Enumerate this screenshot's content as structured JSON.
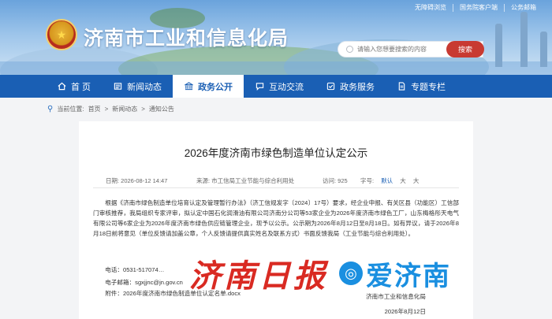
{
  "header": {
    "site_title": "济南市工业和信息化局",
    "top_links": [
      "无障碍浏览",
      "国务院客户端",
      "公务邮箱"
    ],
    "search_placeholder": "请输入您想要搜索的内容",
    "search_button": "搜索"
  },
  "nav": {
    "items": [
      {
        "label": "首 页",
        "icon": "home-icon"
      },
      {
        "label": "新闻动态",
        "icon": "newspaper-icon"
      },
      {
        "label": "政务公开",
        "icon": "government-icon"
      },
      {
        "label": "互动交流",
        "icon": "chat-icon"
      },
      {
        "label": "政务服务",
        "icon": "service-icon"
      },
      {
        "label": "专题专栏",
        "icon": "document-icon"
      }
    ],
    "active_index": 2
  },
  "breadcrumb": {
    "prefix": "当前位置:",
    "items": [
      "首页",
      "新闻动态",
      "通知公告"
    ],
    "separator": ">"
  },
  "article": {
    "title": "2026年度济南市绿色制造单位认定公示",
    "date": "日期: 2026-08-12 14:47",
    "source": "来源: 市工信局工业节能与综合利用处",
    "views": "访问: 925",
    "font_size_label": "字号:",
    "font_sizes": [
      "默认",
      "大",
      "大"
    ],
    "body": "根据《济南市绿色制造单位培育认定及管理暂行办法》（济工信规发字〔2024〕17号）要求，经企业申报、有关区县（功能区）工信部门审核推荐，我局组织专家评审，拟认定中国石化润滑油有限公司济南分公司等53家企业为2026年度济南市绿色工厂，山东梅格彤天电气有限公司等6家企业为2026年度济南市绿色供应链管理企业，现予以公示。公示期为2026年8月12日至8月18日。如有异议，请于2026年8月18日前将意见（单位反馈请加盖公章，个人反馈请提供真实姓名及联系方式）书面反馈我局（工业节能与综合利用处）。",
    "phone": "电话：0531-517074…",
    "email": "电子邮箱：sgxjjnc@jn.gov.cn",
    "attachment": "附件：2026年度济南市绿色制造单位认定名单.docx",
    "signature_org": "济南市工业和信息化局",
    "signature_date": "2026年8月12日"
  },
  "watermark": {
    "red_text": "济南日报",
    "blue_text": "爱济南",
    "red_color": "#d71f17",
    "blue_color": "#1a8fe0"
  },
  "colors": {
    "nav_bg": "#1a5fb4",
    "search_button_bg": "#c83a32"
  }
}
